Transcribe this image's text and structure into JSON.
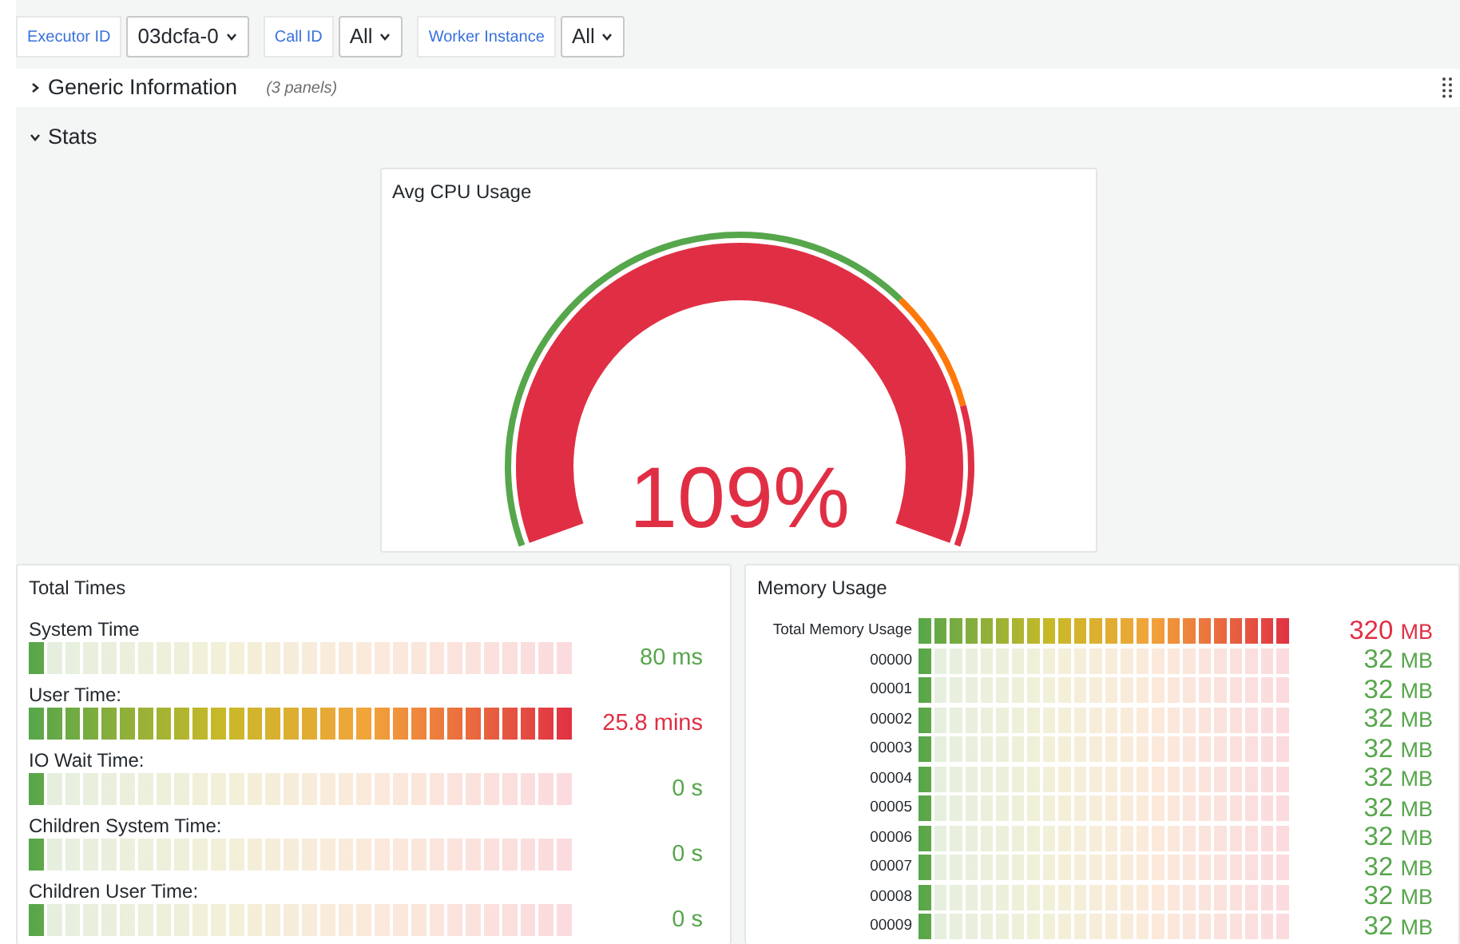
{
  "variables": [
    {
      "label": "Executor ID",
      "value": "03dcfa-0"
    },
    {
      "label": "Call ID",
      "value": "All"
    },
    {
      "label": "Worker Instance",
      "value": "All"
    }
  ],
  "rows": [
    {
      "title": "Generic Information",
      "note": "(3 panels)",
      "expanded": false
    },
    {
      "title": "Stats",
      "expanded": true
    }
  ],
  "cpu_gauge": {
    "title": "Avg CPU Usage",
    "value": "109%",
    "level": 1
  },
  "total_times": {
    "title": "Total Times",
    "rows": [
      {
        "label": "System Time",
        "level": 0.033,
        "value": "80 ms",
        "color": "#56a64b"
      },
      {
        "label": "User Time:",
        "level": 1,
        "value": "25.8 mins",
        "color": "#e02f44"
      },
      {
        "label": "IO Wait Time:",
        "level": 0.033,
        "value": "0 s",
        "color": "#56a64b"
      },
      {
        "label": "Children System Time:",
        "level": 0.033,
        "value": "0 s",
        "color": "#56a64b"
      },
      {
        "label": "Children User Time:",
        "level": 0.033,
        "value": "0 s",
        "color": "#56a64b"
      }
    ]
  },
  "memory_usage": {
    "title": "Memory Usage",
    "rows": [
      {
        "label": "Total Memory Usage",
        "level": 1,
        "value": "320",
        "unit": "MB",
        "color": "#e02f44"
      },
      {
        "label": "00000",
        "level": 0.042,
        "value": "32",
        "unit": "MB",
        "color": "#56a64b"
      },
      {
        "label": "00001",
        "level": 0.042,
        "value": "32",
        "unit": "MB",
        "color": "#56a64b"
      },
      {
        "label": "00002",
        "level": 0.042,
        "value": "32",
        "unit": "MB",
        "color": "#56a64b"
      },
      {
        "label": "00003",
        "level": 0.042,
        "value": "32",
        "unit": "MB",
        "color": "#56a64b"
      },
      {
        "label": "00004",
        "level": 0.042,
        "value": "32",
        "unit": "MB",
        "color": "#56a64b"
      },
      {
        "label": "00005",
        "level": 0.042,
        "value": "32",
        "unit": "MB",
        "color": "#56a64b"
      },
      {
        "label": "00006",
        "level": 0.042,
        "value": "32",
        "unit": "MB",
        "color": "#56a64b"
      },
      {
        "label": "00007",
        "level": 0.042,
        "value": "32",
        "unit": "MB",
        "color": "#56a64b"
      },
      {
        "label": "00008",
        "level": 0.042,
        "value": "32",
        "unit": "MB",
        "color": "#56a64b"
      },
      {
        "label": "00009",
        "level": 0.042,
        "value": "32",
        "unit": "MB",
        "color": "#56a64b"
      }
    ]
  }
}
